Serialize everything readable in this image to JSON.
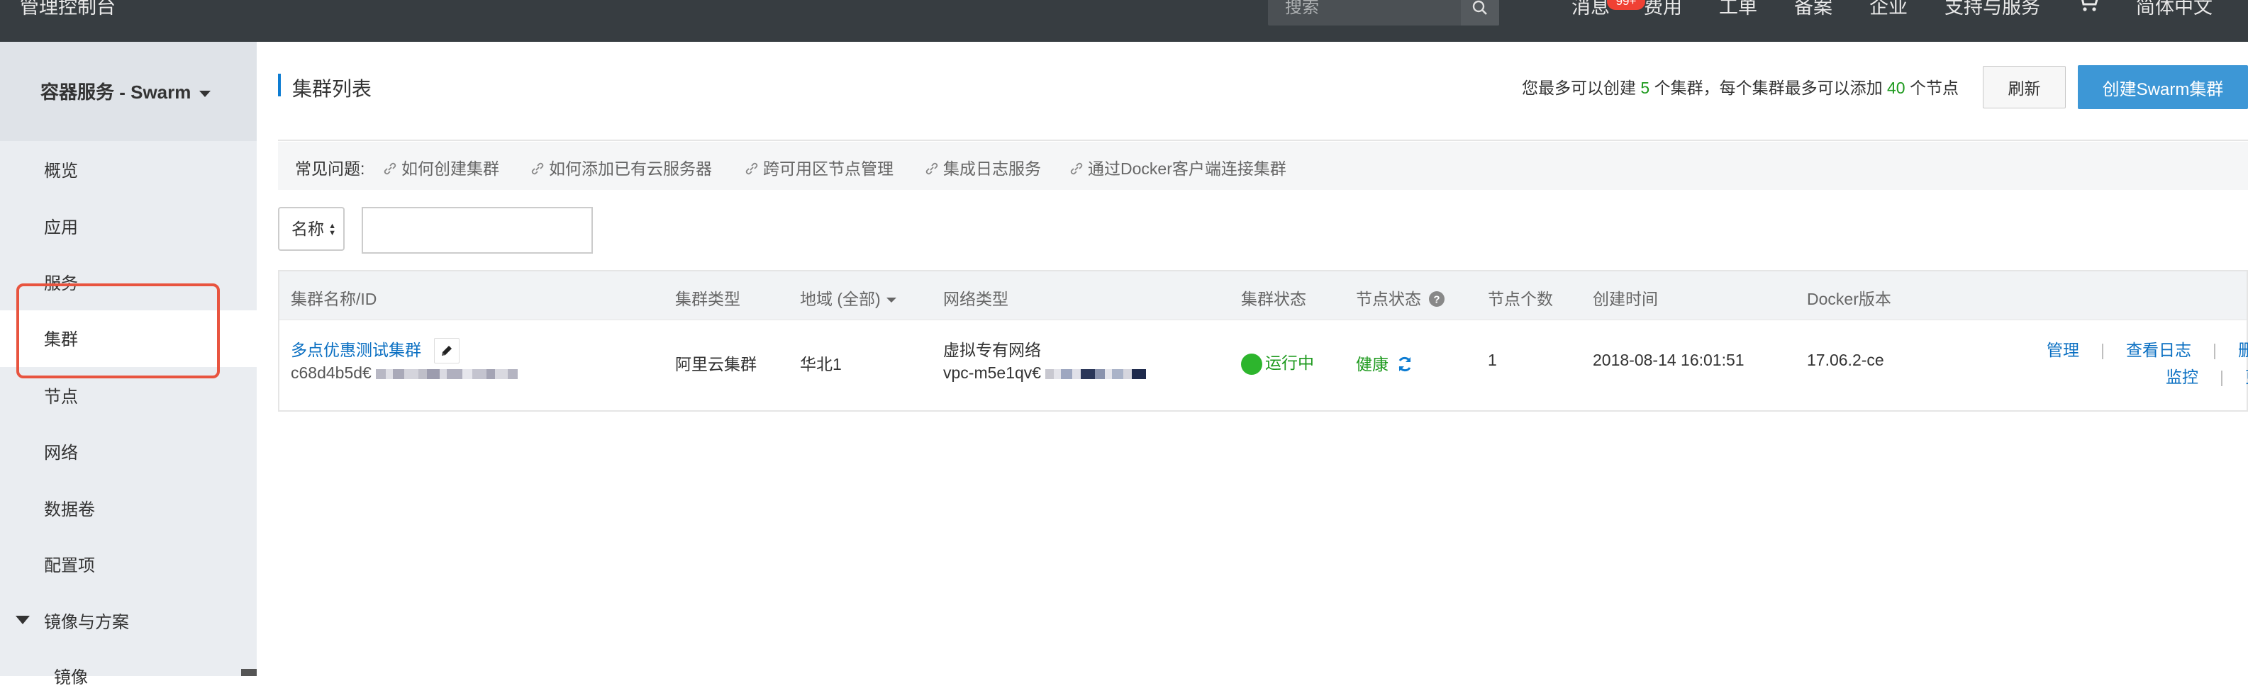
{
  "topbar": {
    "brand": "管理控制台",
    "search_placeholder": "搜索",
    "nav": [
      "消息",
      "费用",
      "工单",
      "备案",
      "企业",
      "支持与服务",
      "简体中文"
    ],
    "badge": "99+"
  },
  "sidebar": {
    "title": "容器服务 - Swarm",
    "items": [
      "概览",
      "应用",
      "服务",
      "集群",
      "节点",
      "网络",
      "数据卷",
      "配置项"
    ],
    "group": "镜像与方案",
    "subitem": "镜像"
  },
  "main": {
    "title": "集群列表",
    "quota_prefix": "您最多可以创建",
    "quota_clusters": "5",
    "quota_middle": "个集群，每个集群最多可以添加",
    "quota_nodes": "40",
    "quota_suffix": "个节点",
    "refresh": "刷新",
    "create": "创建Swarm集群",
    "faq_label": "常见问题:",
    "faq_links": [
      "如何创建集群",
      "如何添加已有云服务器",
      "跨可用区节点管理",
      "集成日志服务",
      "通过Docker客户端连接集群"
    ],
    "filter_select": "名称"
  },
  "table": {
    "headers": [
      "集群名称/ID",
      "集群类型",
      "地域 (全部)",
      "网络类型",
      "集群状态",
      "节点状态",
      "节点个数",
      "创建时间",
      "Docker版本"
    ],
    "row": {
      "name": "多点优惠测试集群",
      "id": "c68d4b5d€",
      "type": "阿里云集群",
      "region": "华北1",
      "network": "虚拟专有网络",
      "vpc": "vpc-m5e1qv€",
      "status": "运行中",
      "node_status": "健康",
      "node_count": "1",
      "created": "2018-08-14 16:01:51",
      "docker": "17.06.2-ce",
      "ops": [
        "管理",
        "查看日志",
        "删",
        "监控",
        "更"
      ]
    }
  }
}
